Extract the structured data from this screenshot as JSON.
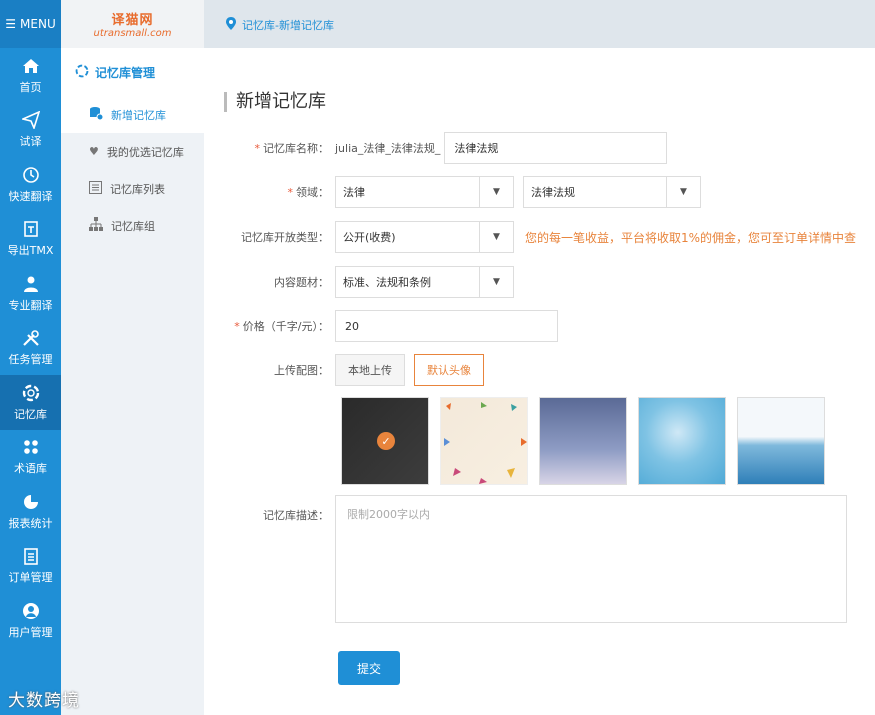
{
  "menu": {
    "label": "MENU"
  },
  "logo": {
    "cn": "译猫网",
    "en": "utransmall.com"
  },
  "breadcrumb": "记忆库-新增记忆库",
  "nav": [
    {
      "label": "首页",
      "icon": "home-icon"
    },
    {
      "label": "试译",
      "icon": "paper-plane-icon"
    },
    {
      "label": "快速翻译",
      "icon": "clock-icon"
    },
    {
      "label": "导出TMX",
      "icon": "export-icon"
    },
    {
      "label": "专业翻译",
      "icon": "translator-icon"
    },
    {
      "label": "任务管理",
      "icon": "tools-icon"
    },
    {
      "label": "记忆库",
      "icon": "lifebuoy-icon",
      "active": true
    },
    {
      "label": "术语库",
      "icon": "grid-dots-icon"
    },
    {
      "label": "报表统计",
      "icon": "pie-chart-icon"
    },
    {
      "label": "订单管理",
      "icon": "clipboard-icon"
    },
    {
      "label": "用户管理",
      "icon": "user-icon"
    }
  ],
  "subnav": {
    "title": "记忆库管理",
    "items": [
      {
        "label": "新增记忆库",
        "icon": "database-add-icon",
        "active": true
      },
      {
        "label": "我的优选记忆库",
        "icon": "heart-icon"
      },
      {
        "label": "记忆库列表",
        "icon": "list-icon"
      },
      {
        "label": "记忆库组",
        "icon": "org-chart-icon"
      }
    ]
  },
  "form": {
    "title": "新增记忆库",
    "name_label": "记忆库名称：",
    "name_prefix": "julia_法律_法律法规_",
    "name_value": "法律法规",
    "domain_label": "领域：",
    "domain_value": "法律",
    "subdomain_value": "法律法规",
    "open_type_label": "记忆库开放类型：",
    "open_type_value": "公开(收费)",
    "open_type_note": "您的每一笔收益，平台将收取1%的佣金，您可至订单详情中查",
    "subject_label": "内容题材：",
    "subject_value": "标准、法规和条例",
    "price_label": "价格（千字/元）：",
    "price_value": "20",
    "upload_label": "上传配图：",
    "upload_local": "本地上传",
    "upload_default": "默认头像",
    "desc_label": "记忆库描述：",
    "desc_placeholder": "限制2000字以内",
    "submit": "提交"
  },
  "watermark": "大数跨境",
  "colors": {
    "primary": "#1f8fd6",
    "accent": "#e8843c",
    "required": "#e85a3b"
  }
}
